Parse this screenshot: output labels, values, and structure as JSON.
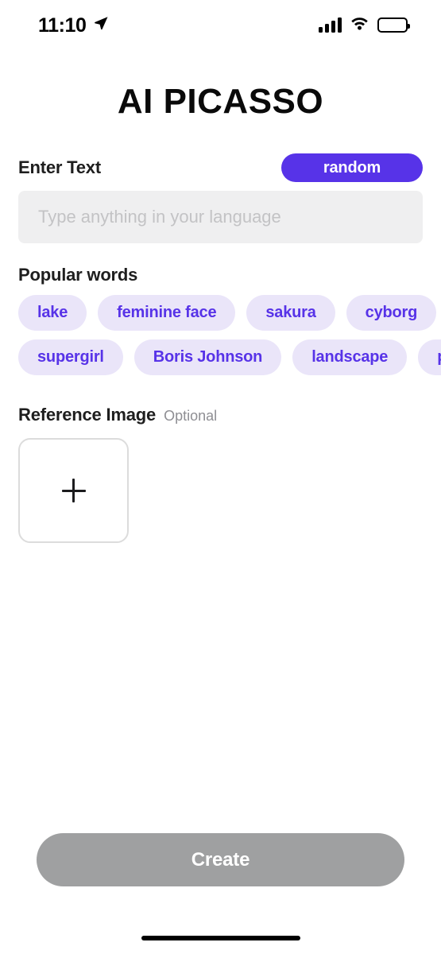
{
  "status_bar": {
    "time": "11:10",
    "location_icon": "location-arrow-icon",
    "signal_icon": "cellular-signal-icon",
    "wifi_icon": "wifi-icon",
    "battery_icon": "battery-full-icon"
  },
  "app": {
    "title": "AI PICASSO"
  },
  "enter_text": {
    "label": "Enter Text",
    "random_label": "random",
    "input_value": "",
    "input_placeholder": "Type anything in your language"
  },
  "popular_words": {
    "title": "Popular words",
    "row1": [
      "lake",
      "feminine face",
      "sakura",
      "cyborg"
    ],
    "row2": [
      "supergirl",
      "Boris Johnson",
      "landscape",
      "p"
    ]
  },
  "reference_image": {
    "title": "Reference Image",
    "optional": "Optional",
    "add_icon": "plus-icon"
  },
  "footer": {
    "create_label": "Create"
  },
  "colors": {
    "accent": "#5733e8",
    "chip_bg": "#eae5f9",
    "input_bg": "#efeff0",
    "disabled_button": "#9fa0a1",
    "text": "#1e1e1e",
    "muted": "#8e8e93"
  }
}
